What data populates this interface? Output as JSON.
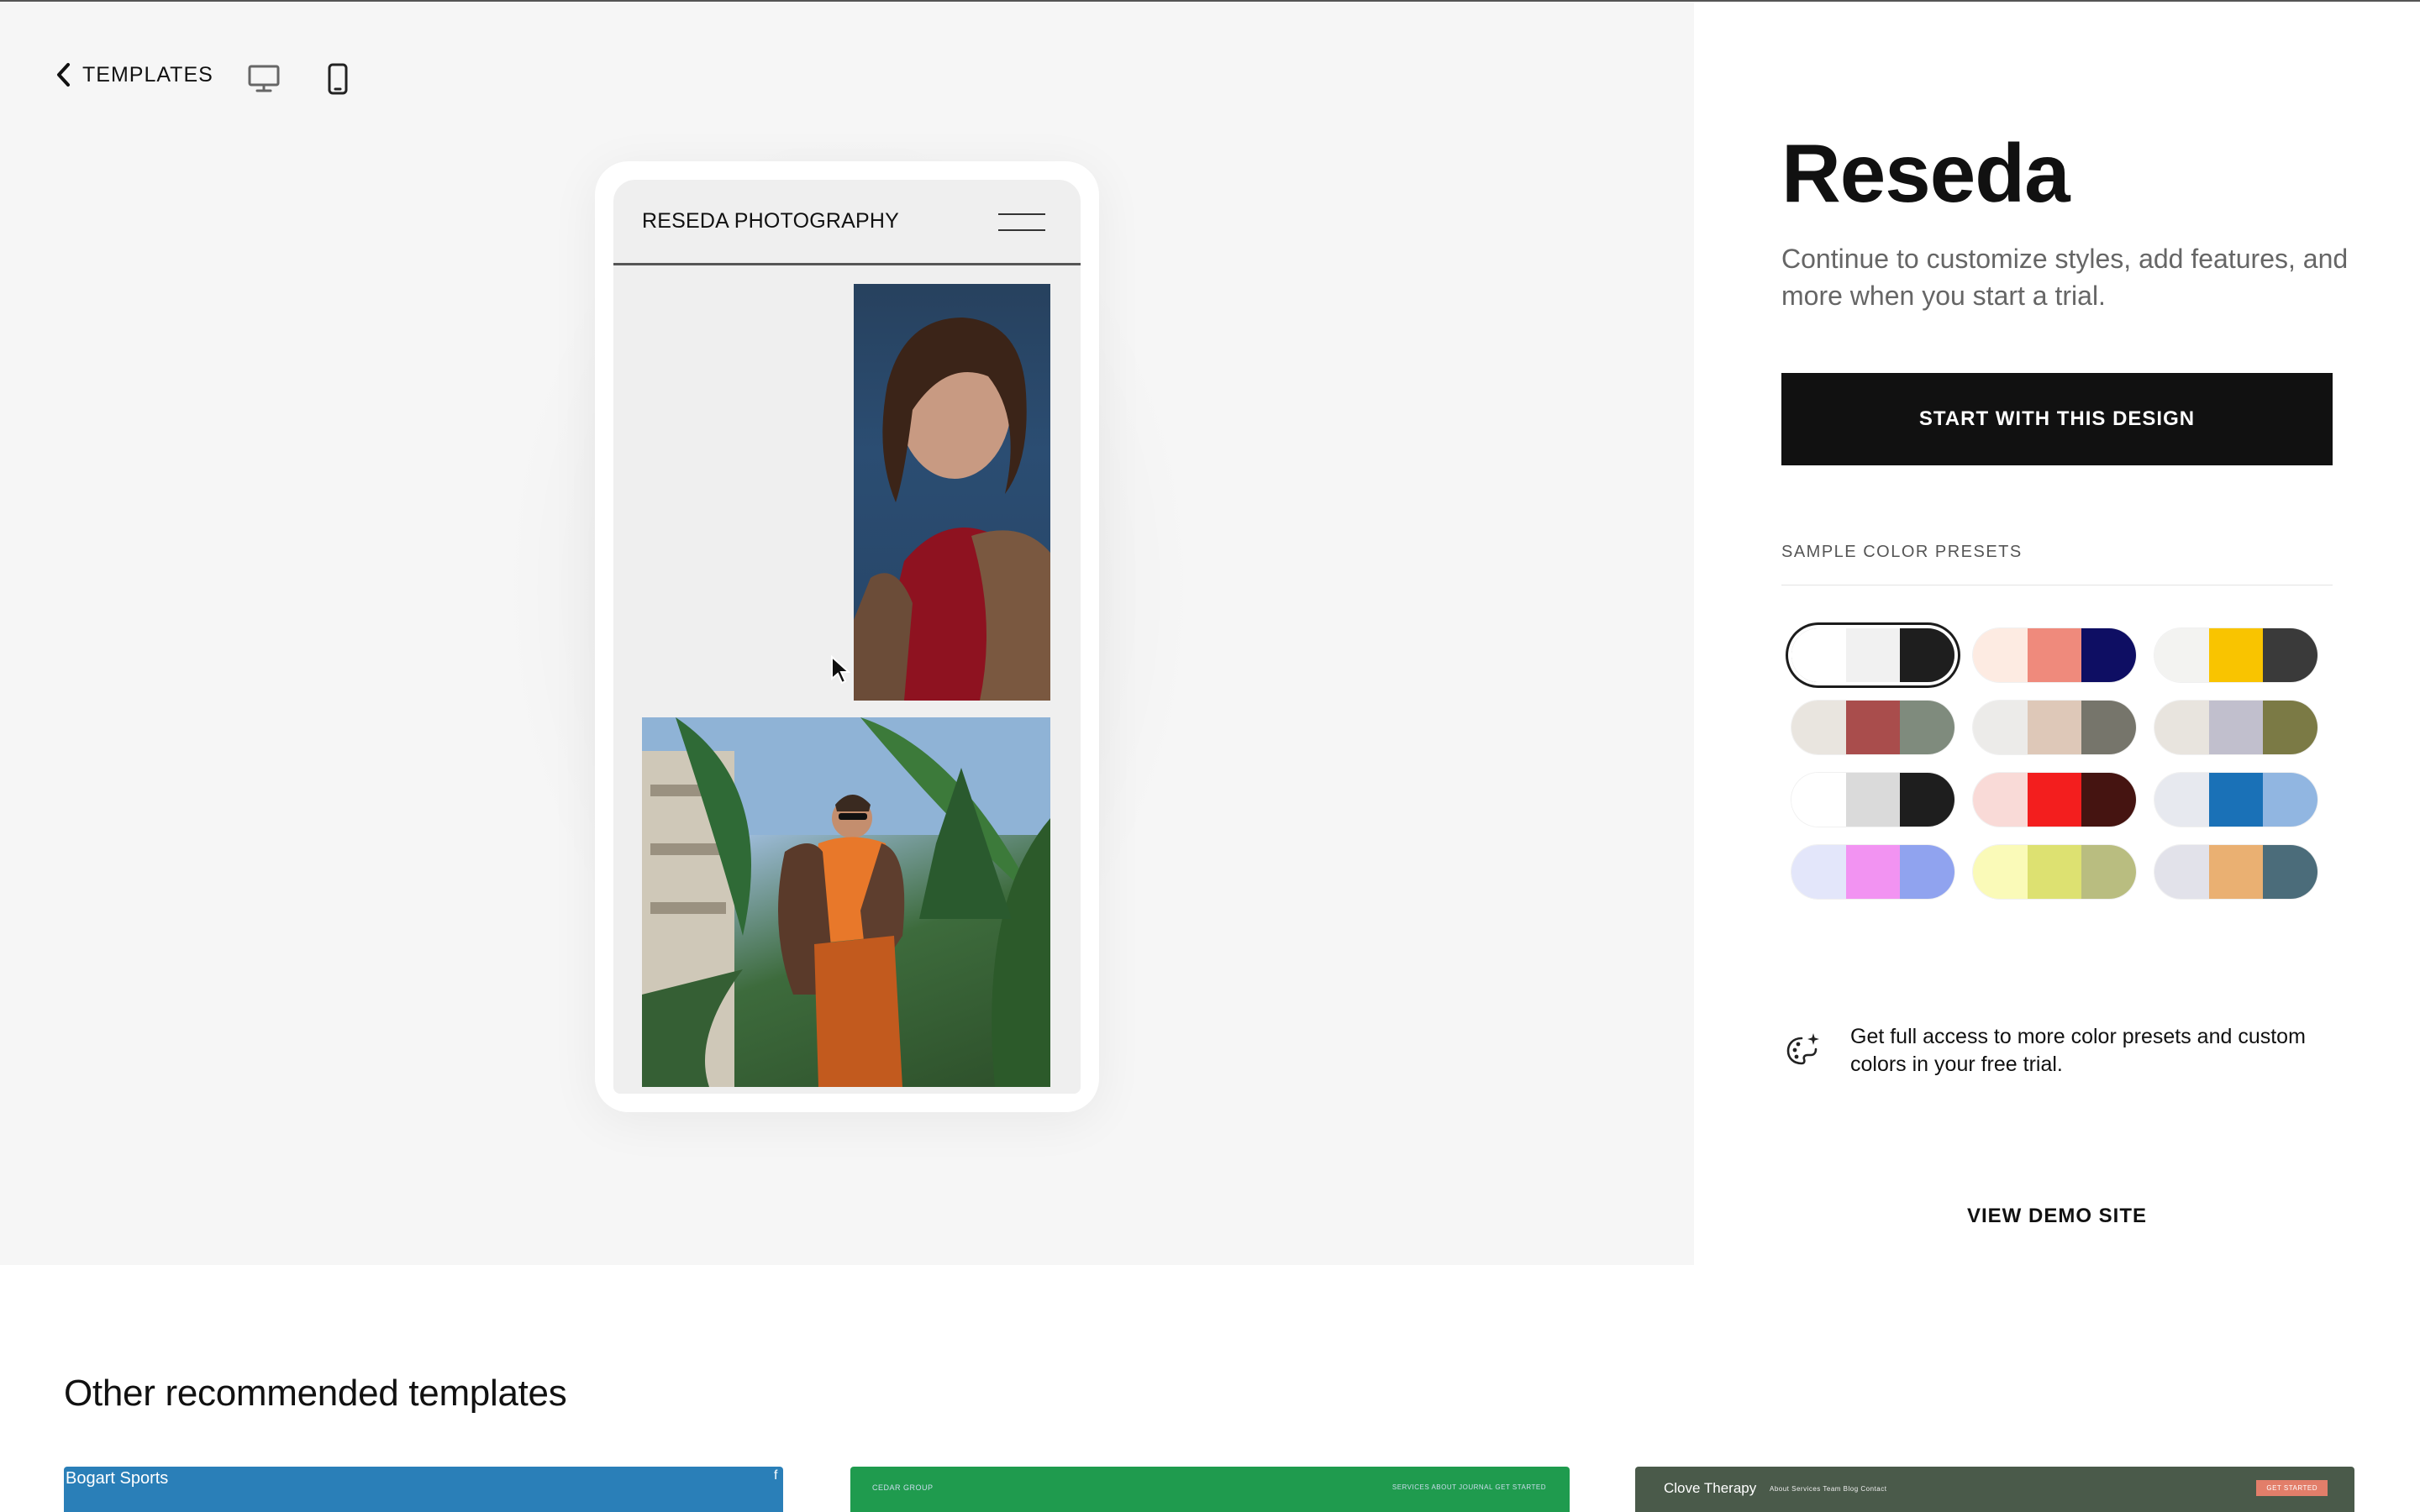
{
  "nav": {
    "back_label": "TEMPLATES",
    "desktop_icon": "desktop-icon",
    "mobile_icon": "mobile-icon"
  },
  "preview": {
    "site_title": "RESEDA PHOTOGRAPHY",
    "menu_icon": "hamburger-menu-icon"
  },
  "details": {
    "title": "Reseda",
    "subtitle": "Continue to customize styles, add features, and more when you start a trial.",
    "cta_label": "START WITH THIS DESIGN",
    "presets_heading": "SAMPLE COLOR PRESETS",
    "presets": [
      {
        "colors": [
          "#ffffff",
          "#f1f1f1",
          "#1e1e1e"
        ],
        "selected": true
      },
      {
        "colors": [
          "#fdebe2",
          "#ef8a7c",
          "#0e0e63"
        ],
        "selected": false
      },
      {
        "colors": [
          "#f3f3f1",
          "#f9c400",
          "#3a3a3a"
        ],
        "selected": false
      },
      {
        "colors": [
          "#e9e5df",
          "#a94d4c",
          "#7f8b7d"
        ],
        "selected": false
      },
      {
        "colors": [
          "#ecebe9",
          "#dec8b8",
          "#76756b"
        ],
        "selected": false
      },
      {
        "colors": [
          "#e8e4de",
          "#c1bfcd",
          "#7b7a45"
        ],
        "selected": false
      },
      {
        "colors": [
          "#ffffff",
          "#dadada",
          "#1e1e1e"
        ],
        "selected": false
      },
      {
        "colors": [
          "#f9dad7",
          "#f31e1e",
          "#451411"
        ],
        "selected": false
      },
      {
        "colors": [
          "#e7e9ef",
          "#1a71b7",
          "#91b6e1"
        ],
        "selected": false
      },
      {
        "colors": [
          "#e3e6fa",
          "#f293f2",
          "#90a3ef"
        ],
        "selected": false
      },
      {
        "colors": [
          "#fafab8",
          "#dde171",
          "#b9bd80"
        ],
        "selected": false
      },
      {
        "colors": [
          "#e2e2ea",
          "#eab072",
          "#4b6c7a"
        ],
        "selected": false
      }
    ],
    "promo_icon": "palette-sparkle-icon",
    "promo_text": "Get full access to more color presets and custom colors in your free trial.",
    "demo_label": "VIEW DEMO SITE"
  },
  "recommended": {
    "heading": "Other recommended templates",
    "cards": [
      {
        "label": "Bogart Sports",
        "nav": "f",
        "color": "#2a7fb8"
      },
      {
        "label": "CEDAR GROUP",
        "nav": "SERVICES   ABOUT   JOURNAL   GET STARTED",
        "color": "#1f9b4e"
      },
      {
        "label": "Clove Therapy",
        "nav": "About   Services   Team   Blog   Contact",
        "button": "GET STARTED",
        "color": "#4a5a4a"
      }
    ]
  }
}
